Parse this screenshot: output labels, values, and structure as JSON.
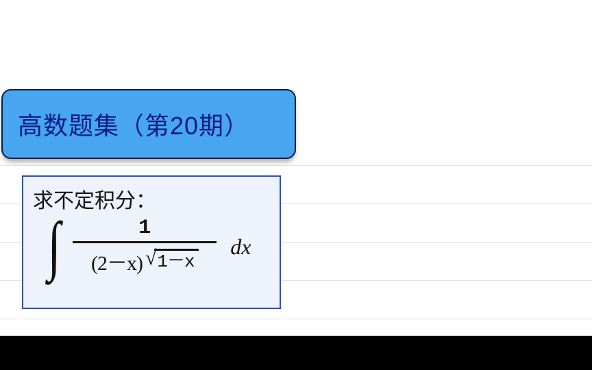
{
  "title": "高数题集（第20期）",
  "problem": {
    "prompt": "求不定积分：",
    "integral_sign": "∫",
    "numerator": "1",
    "denominator_paren": "(2－x)",
    "radical_sign": "√",
    "radicand": "1－x",
    "dx": "dx"
  }
}
